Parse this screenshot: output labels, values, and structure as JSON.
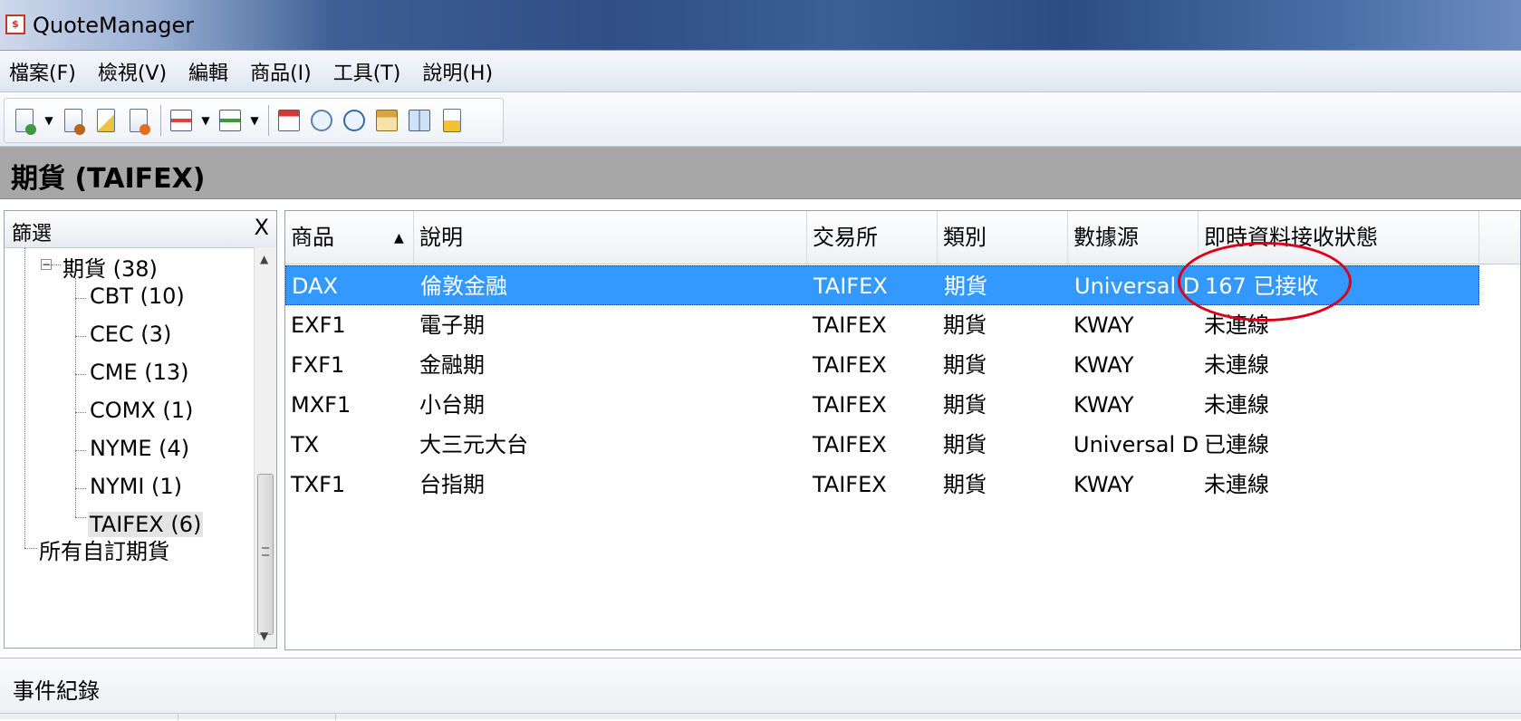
{
  "window": {
    "title": "QuoteManager",
    "icon": "app-icon"
  },
  "menu": [
    "檔案(F)",
    "檢視(V)",
    "編輯",
    "商品(I)",
    "工具(T)",
    "說明(H)"
  ],
  "toolbar": {
    "icons": [
      "new-document-icon",
      "dropdown-arrow-icon",
      "document-properties-icon",
      "edit-document-icon",
      "document-settings-icon",
      "export-icon",
      "dropdown-arrow-icon",
      "import-icon",
      "dropdown-arrow-icon",
      "calendar-icon",
      "search-icon",
      "clock-icon",
      "bank-icon",
      "book-icon",
      "alert-document-icon"
    ]
  },
  "section": {
    "title": "期貨 (TAIFEX)"
  },
  "filter": {
    "title": "篩選",
    "close": "X",
    "tree": {
      "root": "期貨 (38)",
      "children": [
        "CBT (10)",
        "CEC (3)",
        "CME (13)",
        "COMX (1)",
        "NYME (4)",
        "NYMI (1)",
        "TAIFEX (6)"
      ],
      "other": "所有自訂期貨"
    }
  },
  "grid": {
    "columns": [
      "商品",
      "說明",
      "交易所",
      "類別",
      "數據源",
      "即時資料接收狀態"
    ],
    "sort_indicator": "▲",
    "rows": [
      {
        "symbol": "DAX",
        "desc": "倫敦金融",
        "exchange": "TAIFEX",
        "type": "期貨",
        "source": "Universal DDE",
        "status": "167 已接收",
        "selected": true
      },
      {
        "symbol": "EXF1",
        "desc": "電子期",
        "exchange": "TAIFEX",
        "type": "期貨",
        "source": "KWAY",
        "status": "未連線"
      },
      {
        "symbol": "FXF1",
        "desc": "金融期",
        "exchange": "TAIFEX",
        "type": "期貨",
        "source": "KWAY",
        "status": "未連線"
      },
      {
        "symbol": "MXF1",
        "desc": "小台期",
        "exchange": "TAIFEX",
        "type": "期貨",
        "source": "KWAY",
        "status": "未連線"
      },
      {
        "symbol": "TX",
        "desc": "大三元大台",
        "exchange": "TAIFEX",
        "type": "期貨",
        "source": "Universal DDE",
        "status": "已連線"
      },
      {
        "symbol": "TXF1",
        "desc": "台指期",
        "exchange": "TAIFEX",
        "type": "期貨",
        "source": "KWAY",
        "status": "未連線"
      }
    ]
  },
  "events": {
    "title": "事件紀錄"
  },
  "colors": {
    "selection": "#3399ff",
    "annotation": "#d9001b",
    "section_header": "#a7a7a7"
  }
}
